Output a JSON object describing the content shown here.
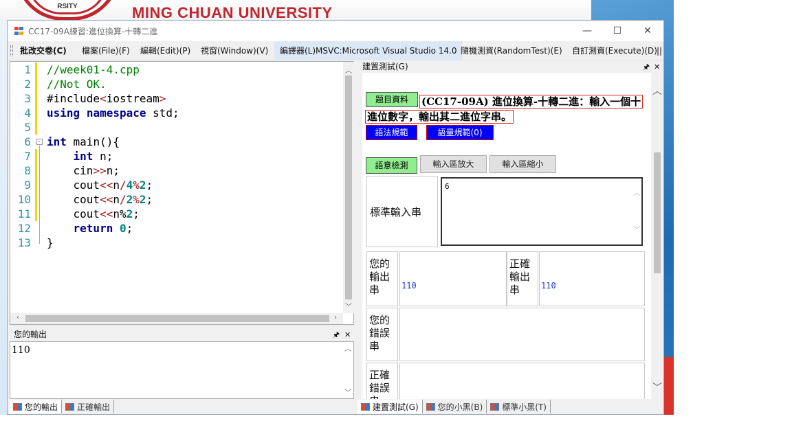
{
  "desktop": {
    "university_name": "MING CHUAN UNIVERSITY",
    "logo_text": "RSITY"
  },
  "window": {
    "title": "CC17-09A練習:進位換算-十轉二進",
    "controls": {
      "minimize": "—",
      "maximize": "☐",
      "close": "✕"
    }
  },
  "menu": [
    {
      "label": "批改交卷(C)"
    },
    {
      "label": "檔案(File)(F)"
    },
    {
      "label": "編輯(Edit)(P)"
    },
    {
      "label": "視窗(Window)(V)"
    },
    {
      "label": "編譯器(L)MSVC:Microsoft Visual Studio 14.0"
    },
    {
      "label": "隨機測資(RandomTest)(E)"
    },
    {
      "label": "自訂測資(Execute)(D)"
    }
  ],
  "editor": {
    "line_numbers": [
      "1",
      "2",
      "3",
      "4",
      "5",
      "6",
      "7",
      "8",
      "9",
      "10",
      "11",
      "12",
      "13"
    ],
    "lines": [
      [
        {
          "t": "//week01-4.cpp",
          "c": "cm"
        }
      ],
      [
        {
          "t": "//Not OK.",
          "c": "cm"
        }
      ],
      [
        {
          "t": "#include",
          "c": ""
        },
        {
          "t": "<",
          "c": "op"
        },
        {
          "t": "iostream",
          "c": ""
        },
        {
          "t": ">",
          "c": "op"
        }
      ],
      [
        {
          "t": "using",
          "c": "kw"
        },
        {
          "t": " ",
          "c": ""
        },
        {
          "t": "namespace",
          "c": "kw"
        },
        {
          "t": " std;",
          "c": ""
        }
      ],
      [
        {
          "t": "",
          "c": ""
        }
      ],
      [
        {
          "t": "int",
          "c": "kw"
        },
        {
          "t": " main(){",
          "c": ""
        }
      ],
      [
        {
          "t": "    ",
          "c": ""
        },
        {
          "t": "int",
          "c": "kw"
        },
        {
          "t": " n;",
          "c": ""
        }
      ],
      [
        {
          "t": "    cin",
          "c": ""
        },
        {
          "t": ">>",
          "c": "op"
        },
        {
          "t": "n;",
          "c": ""
        }
      ],
      [
        {
          "t": "    cout",
          "c": ""
        },
        {
          "t": "<<",
          "c": "op"
        },
        {
          "t": "n",
          "c": ""
        },
        {
          "t": "/",
          "c": "op"
        },
        {
          "t": "4",
          "c": "num"
        },
        {
          "t": "%",
          "c": "op"
        },
        {
          "t": "2",
          "c": "num"
        },
        {
          "t": ";",
          "c": ""
        }
      ],
      [
        {
          "t": "    cout",
          "c": ""
        },
        {
          "t": "<<",
          "c": "op"
        },
        {
          "t": "n",
          "c": ""
        },
        {
          "t": "/",
          "c": "op"
        },
        {
          "t": "2",
          "c": "num"
        },
        {
          "t": "%",
          "c": "op"
        },
        {
          "t": "2",
          "c": "num"
        },
        {
          "t": ";",
          "c": ""
        }
      ],
      [
        {
          "t": "    cout",
          "c": ""
        },
        {
          "t": "<<",
          "c": "op"
        },
        {
          "t": "n%",
          "c": ""
        },
        {
          "t": "2",
          "c": "num"
        },
        {
          "t": ";",
          "c": ""
        }
      ],
      [
        {
          "t": "    ",
          "c": ""
        },
        {
          "t": "return",
          "c": "kw"
        },
        {
          "t": " ",
          "c": ""
        },
        {
          "t": "0",
          "c": "num"
        },
        {
          "t": ";",
          "c": ""
        }
      ],
      [
        {
          "t": "}",
          "c": ""
        }
      ]
    ],
    "changed_lines": [
      1,
      2,
      3,
      4,
      5,
      7,
      8,
      9,
      10,
      11
    ]
  },
  "output_panel": {
    "title": "您的輸出",
    "content": "110"
  },
  "bottom_tabs_left": [
    {
      "label": "您的輸出"
    },
    {
      "label": "正確輸出"
    }
  ],
  "right_panel": {
    "title": "建置測試(G)",
    "problem_button": "題目資料",
    "problem_text_line1": "(CC17-09A) 進位換算-十轉二進：輸入一個十",
    "problem_text_line2": "進位數字，輸出其二進位字串。",
    "syntax_button": "語法規範",
    "volume_button": "語量規範(0)",
    "semantic_button": "語意檢測",
    "enlarge_button": "輸入區放大",
    "shrink_button": "輸入區縮小",
    "stdin_label": "標準輸入串",
    "stdin_value": "6",
    "your_output_label": "您的\n輸出\n串",
    "your_output_value": "110",
    "correct_output_label": "正確\n輸出\n串",
    "correct_output_value": "110",
    "your_error_label": "您的\n錯誤\n串",
    "correct_error_label": "正確\n錯誤\n串"
  },
  "bottom_tabs_right": [
    {
      "label": "建置測試(G)"
    },
    {
      "label": "您的小黑(B)"
    },
    {
      "label": "標準小黑(T)"
    }
  ],
  "colors": {
    "comment": "#008000",
    "keyword": "#00008b",
    "operator": "#a31515",
    "number": "#008080",
    "changed_line": "#f2d700",
    "green_button": "#90ee90",
    "blue_button": "#0000ff",
    "university_red": "#c0262d"
  }
}
